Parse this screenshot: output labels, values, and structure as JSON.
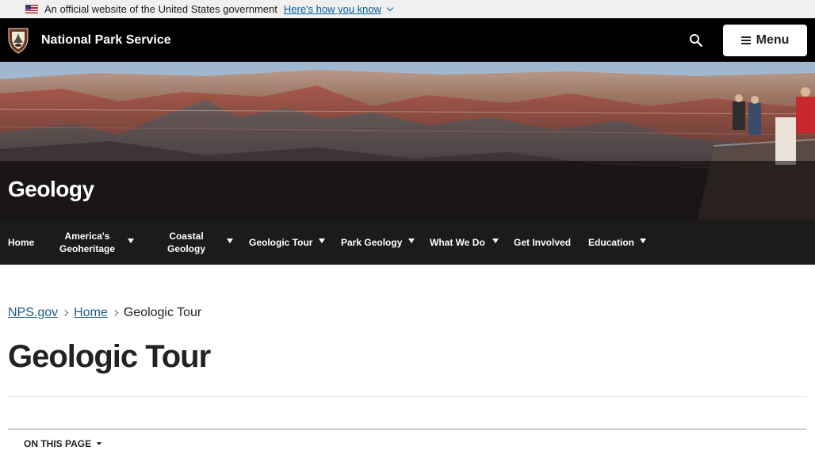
{
  "gov_banner": {
    "text": "An official website of the United States government",
    "link_label": "Here's how you know"
  },
  "header": {
    "site_name": "National Park Service",
    "menu_label": "Menu"
  },
  "hero": {
    "title": "Geology"
  },
  "nav": {
    "items": [
      {
        "label": "Home",
        "has_dropdown": false
      },
      {
        "label": "America's\nGeoheritage",
        "has_dropdown": true
      },
      {
        "label": "Coastal\nGeology",
        "has_dropdown": true
      },
      {
        "label": "Geologic Tour",
        "has_dropdown": true
      },
      {
        "label": "Park Geology",
        "has_dropdown": true
      },
      {
        "label": "What We Do",
        "has_dropdown": true
      },
      {
        "label": "Get Involved",
        "has_dropdown": false
      },
      {
        "label": "Education",
        "has_dropdown": true
      }
    ]
  },
  "breadcrumb": {
    "items": [
      "NPS.gov",
      "Home"
    ],
    "current": "Geologic Tour"
  },
  "page": {
    "title": "Geologic Tour",
    "on_this_page_label": "ON THIS PAGE"
  },
  "colors": {
    "header_bg": "#000000",
    "nav_bg": "#1b1b1b",
    "link": "#1b5a85",
    "gov_link": "#005ea2"
  }
}
